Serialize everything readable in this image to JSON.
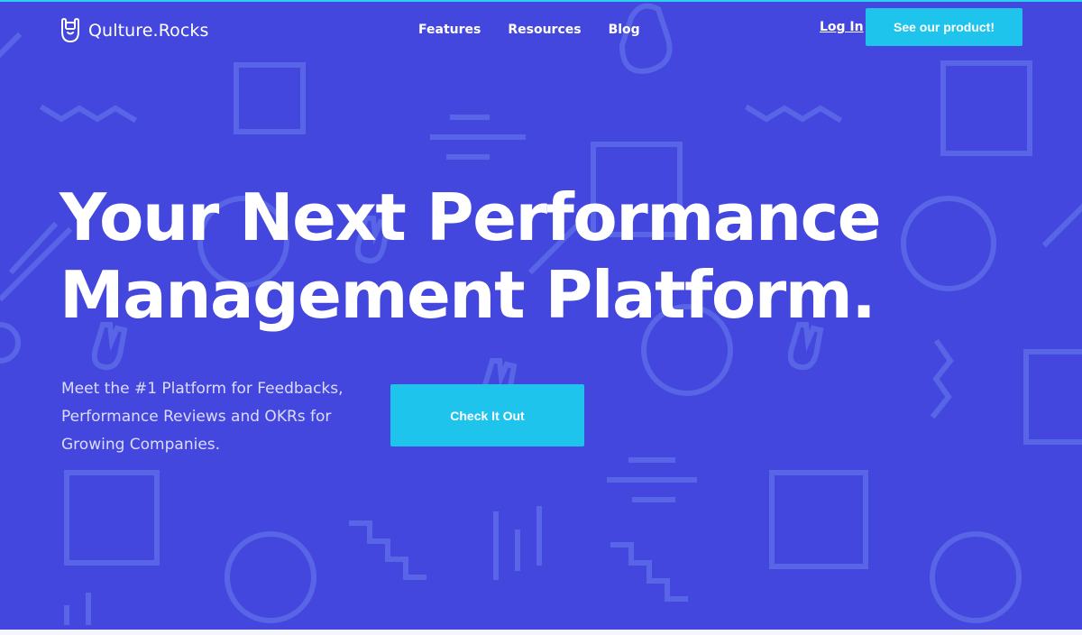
{
  "brand": {
    "name": "Qulture.Rocks",
    "logo_icon": "rock-hand-icon"
  },
  "nav": {
    "items": [
      {
        "label": "Features"
      },
      {
        "label": "Resources"
      },
      {
        "label": "Blog"
      }
    ],
    "login_label": "Log In",
    "cta_label": "See our product!"
  },
  "hero": {
    "headline_line1": "Your Next Performance",
    "headline_line2": "Management Platform.",
    "subheadline": "Meet the #1 Platform for Feedbacks, Performance Reviews and OKRs for Growing Companies.",
    "cta_label": "Check It Out"
  },
  "colors": {
    "background": "#4347de",
    "accent": "#1ec4ec",
    "pattern": "#5765e6"
  }
}
